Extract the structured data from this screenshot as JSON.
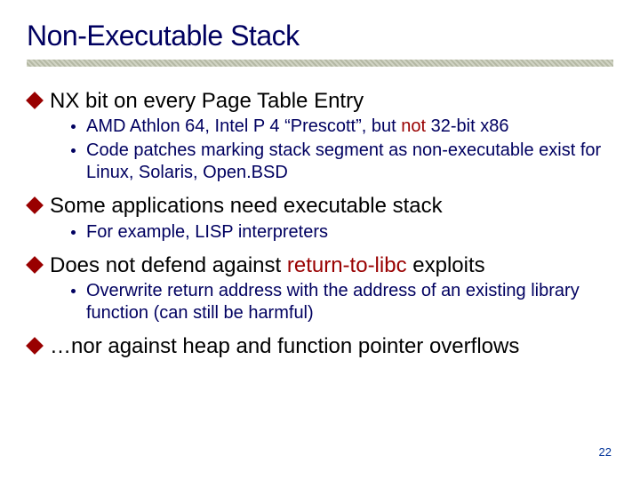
{
  "title": "Non-Executable Stack",
  "bullets": [
    {
      "pre": "NX bit on every Page Table Entry",
      "hl": "",
      "post": "",
      "sub": [
        {
          "pre": "AMD Athlon 64, Intel P 4 “Prescott”, but ",
          "hl": "not",
          "post": " 32-bit x86"
        },
        {
          "pre": "Code patches marking stack segment as non-executable exist for Linux, Solaris, Open.BSD",
          "hl": "",
          "post": ""
        }
      ]
    },
    {
      "pre": "Some applications need executable stack",
      "hl": "",
      "post": "",
      "sub": [
        {
          "pre": "For example, LISP interpreters",
          "hl": "",
          "post": ""
        }
      ]
    },
    {
      "pre": "Does not defend against ",
      "hl": "return-to-libc",
      "post": " exploits",
      "sub": [
        {
          "pre": "Overwrite return address with the address of an existing library function (can still be harmful)",
          "hl": "",
          "post": ""
        }
      ]
    },
    {
      "pre": "…nor against heap and function pointer overflows",
      "hl": "",
      "post": "",
      "sub": []
    }
  ],
  "page_number": "22"
}
